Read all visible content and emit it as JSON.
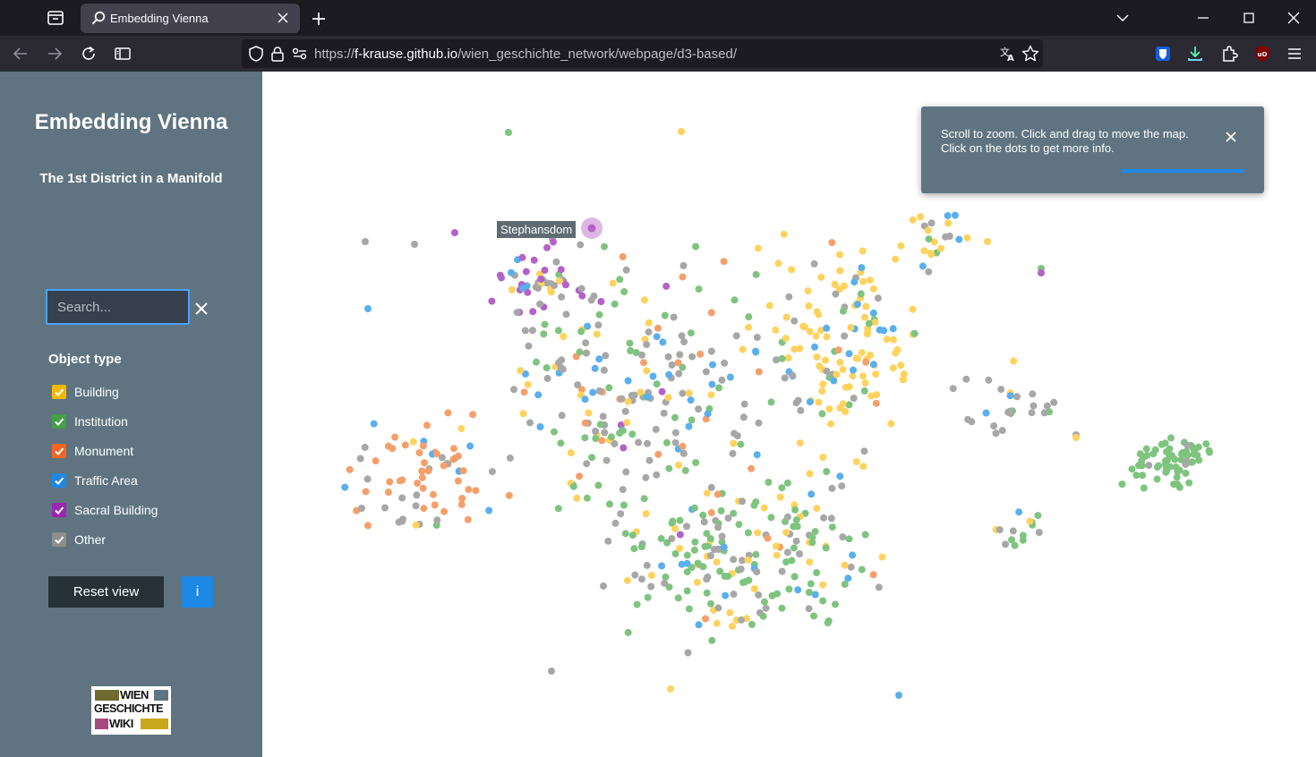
{
  "browser": {
    "tab": {
      "title": "Embedding Vienna"
    },
    "url": {
      "scheme": "https://",
      "host": "f-krause.github.io",
      "path": "/wien_geschichte_network/webpage/d3-based/"
    }
  },
  "sidebar": {
    "title": "Embedding Vienna",
    "subtitle": "The 1st District in a Manifold",
    "search": {
      "placeholder": "Search...",
      "value": ""
    },
    "filter_heading": "Object type",
    "filters": [
      {
        "label": "Building",
        "color": "#f5b800",
        "checked": true
      },
      {
        "label": "Institution",
        "color": "#43a047",
        "checked": true
      },
      {
        "label": "Monument",
        "color": "#f26522",
        "checked": true
      },
      {
        "label": "Traffic Area",
        "color": "#1e88e5",
        "checked": true
      },
      {
        "label": "Sacral Building",
        "color": "#9c27b0",
        "checked": true
      },
      {
        "label": "Other",
        "color": "#8e8e8e",
        "checked": true
      }
    ],
    "reset_label": "Reset view",
    "info_label": "i",
    "logo": {
      "line1": "WIEN",
      "line2": "GESCHICHTE",
      "line3": "WIKI"
    }
  },
  "map": {
    "toast": {
      "text": "Scroll to zoom. Click and drag to move the map. Click on the dots to get more info."
    },
    "tooltip": {
      "label": "Stephansdom"
    },
    "colors": {
      "building": "#fdd35e",
      "institution": "#7ec47f",
      "monument": "#f59f6b",
      "traffic": "#5aafec",
      "sacral": "#b462c8",
      "other": "#a7a7a7"
    }
  }
}
